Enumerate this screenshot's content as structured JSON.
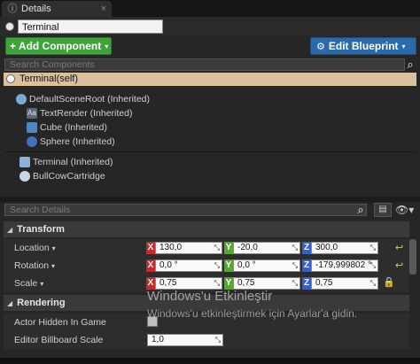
{
  "tab": {
    "icon": "info-icon",
    "title": "Details",
    "close": "×"
  },
  "actor": {
    "name": "Terminal"
  },
  "toolbar": {
    "add_component": "+ Add Component",
    "edit_blueprint": "Edit Blueprint",
    "caret": "▾"
  },
  "components_search": {
    "placeholder": "Search Components"
  },
  "self_row": {
    "label": "Terminal(self)"
  },
  "tree": [
    {
      "label": "DefaultSceneRoot (Inherited)",
      "icon": "scene-root-icon",
      "color": "#7fa7d6"
    },
    {
      "label": "TextRender (Inherited)",
      "icon": "text-render-icon",
      "color": "#9aa7b8"
    },
    {
      "label": "Cube (Inherited)",
      "icon": "cube-icon",
      "color": "#4f86c6"
    },
    {
      "label": "Sphere (Inherited)",
      "icon": "sphere-icon",
      "color": "#3d73c0"
    },
    {
      "label": "Terminal (Inherited)",
      "icon": "terminal-icon",
      "color": "#8fb0d8"
    },
    {
      "label": "BullCowCartridge",
      "icon": "cartridge-icon",
      "color": "#c9d6e6"
    }
  ],
  "details_search": {
    "placeholder": "Search Details"
  },
  "transform": {
    "title": "Transform",
    "location": {
      "label": "Location",
      "x": "130,0",
      "y": "-20,0",
      "z": "300,0"
    },
    "rotation": {
      "label": "Rotation",
      "x": "0,0 °",
      "y": "0,0 °",
      "z": "-179,999802 °"
    },
    "scale": {
      "label": "Scale",
      "x": "0,75",
      "y": "0,75",
      "z": "0,75"
    },
    "axis_labels": {
      "x": "X",
      "y": "Y",
      "z": "Z"
    }
  },
  "rendering": {
    "title": "Rendering",
    "actor_hidden": {
      "label": "Actor Hidden In Game",
      "checked": false
    },
    "billboard_scale": {
      "label": "Editor Billboard Scale",
      "value": "1,0"
    }
  },
  "watermark": {
    "line1": "Windows'u Etkinleştir",
    "line2": "Windows'u etkinleştirmek için Ayarlar'a gidin."
  },
  "colors": {
    "add_green": "#3fa33a",
    "blueprint_blue": "#2a6aa8",
    "selected_row": "#dcc09b",
    "x_axis": "#c02b2b",
    "y_axis": "#56a630",
    "z_axis": "#3a5fc9"
  }
}
